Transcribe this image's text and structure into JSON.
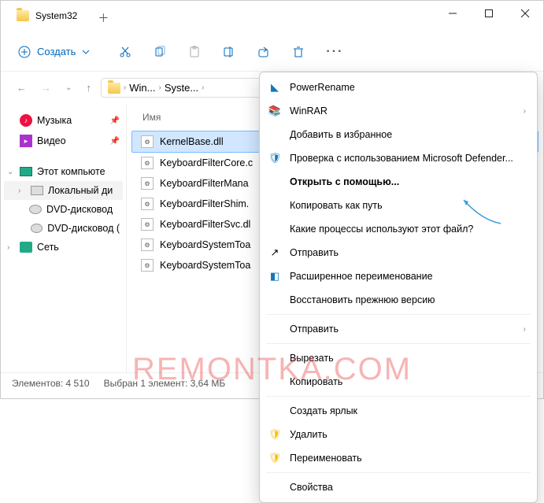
{
  "window": {
    "title": "System32"
  },
  "toolbar": {
    "new_label": "Создать"
  },
  "breadcrumb": {
    "seg1": "Win...",
    "seg2": "Syste...",
    "sep": "›"
  },
  "tree": {
    "music": "Музыка",
    "video": "Видео",
    "pc": "Этот компьюте",
    "local": "Локальный ди",
    "dvd1": "DVD-дисковод",
    "dvd2": "DVD-дисковод (",
    "net": "Сеть"
  },
  "list": {
    "header_name": "Имя",
    "files": [
      "KernelBase.dll",
      "KeyboardFilterCore.c",
      "KeyboardFilterMana",
      "KeyboardFilterShim.",
      "KeyboardFilterSvc.dl",
      "KeyboardSystemToa",
      "KeyboardSystemToa"
    ]
  },
  "status": {
    "count": "Элементов: 4 510",
    "selection": "Выбран 1 элемент: 3,64 МБ"
  },
  "ctx": {
    "powerrename": "PowerRename",
    "winrar": "WinRAR",
    "fav": "Добавить в избранное",
    "defender": "Проверка с использованием Microsoft Defender...",
    "openwith": "Открыть с помощью...",
    "copypath": "Копировать как путь",
    "processes": "Какие процессы используют этот файл?",
    "send": "Отправить",
    "extrename": "Расширенное переименование",
    "restore": "Восстановить прежнюю версию",
    "send2": "Отправить",
    "cut": "Вырезать",
    "copy": "Копировать",
    "shortcut": "Создать ярлык",
    "delete": "Удалить",
    "rename": "Переименовать",
    "props": "Свойства"
  },
  "watermark": "REMONTKA.COM"
}
